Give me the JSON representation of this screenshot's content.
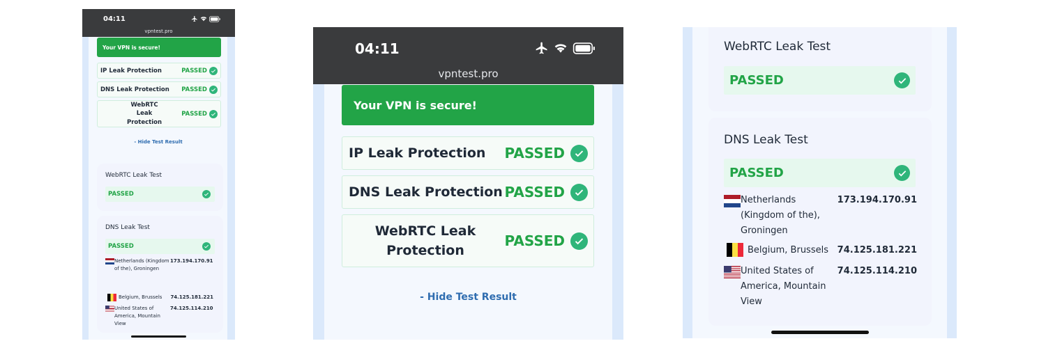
{
  "statusbar": {
    "time": "04:11",
    "url": "vpntest.pro"
  },
  "banner": {
    "text": "Your VPN is secure!"
  },
  "protections": [
    {
      "label": "IP Leak Protection",
      "status": "PASSED"
    },
    {
      "label": "DNS Leak Protection",
      "status": "PASSED"
    },
    {
      "label": "WebRTC Leak Protection",
      "status": "PASSED"
    }
  ],
  "hide_link": "- Hide Test Result",
  "webrtc_test": {
    "title": "WebRTC Leak Test",
    "status": "PASSED"
  },
  "dns_test": {
    "title": "DNS Leak Test",
    "status": "PASSED",
    "servers": [
      {
        "flag": "netherlands-flag",
        "location": "Netherlands (Kingdom of the), Groningen",
        "ip": "173.194.170.91"
      },
      {
        "flag": "belgium-flag",
        "location": "Belgium, Brussels",
        "ip": "74.125.181.221"
      },
      {
        "flag": "usa-flag",
        "location": "United States of America, Mountain View",
        "ip": "74.125.114.210"
      }
    ]
  },
  "icons": {
    "airplane": "airplane-icon",
    "wifi": "wifi-icon",
    "battery": "battery-icon",
    "check": "check-circle-icon"
  },
  "colors": {
    "pass_green": "#22a447",
    "banner_green": "#22a447",
    "link_blue": "#2f6db0",
    "statusbar_dark": "#3a3b3d"
  }
}
